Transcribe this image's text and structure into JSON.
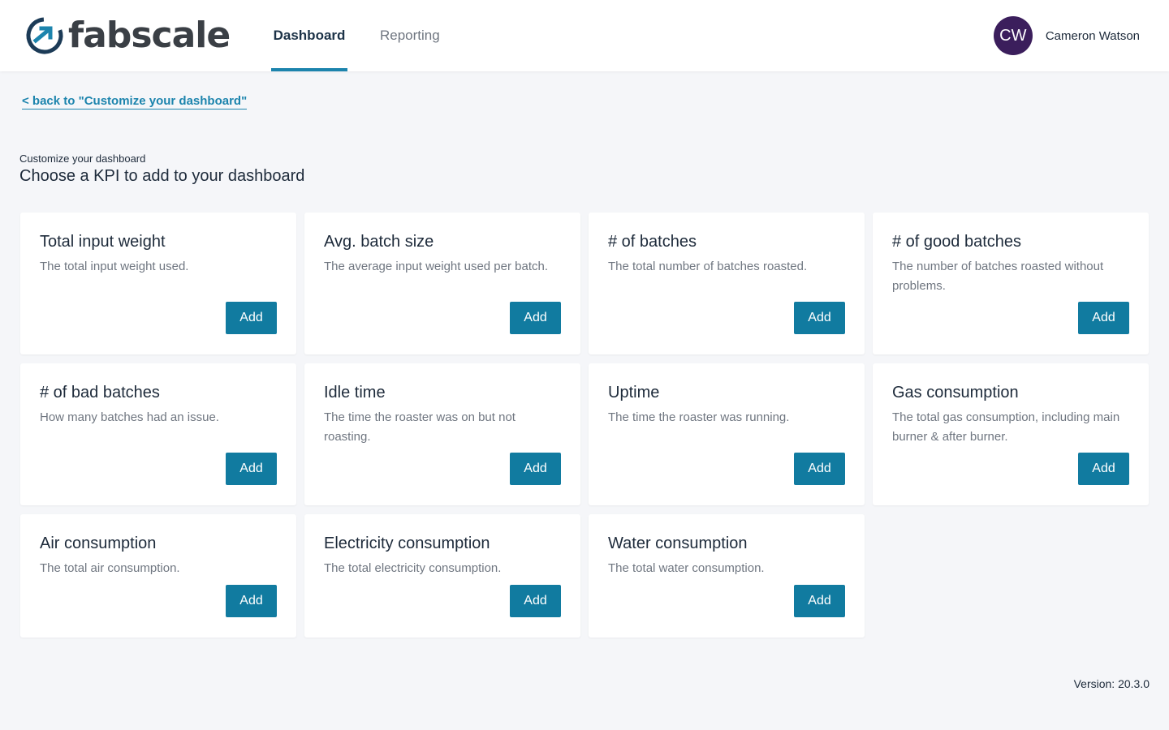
{
  "header": {
    "logo_text": "fabscale",
    "tabs": [
      {
        "label": "Dashboard",
        "active": true
      },
      {
        "label": "Reporting",
        "active": false
      }
    ],
    "user": {
      "initials": "CW",
      "name": "Cameron Watson"
    }
  },
  "page": {
    "back_link": "< back to \"Customize your dashboard\"",
    "subtitle": "Customize your dashboard",
    "title": "Choose a KPI to add to your dashboard"
  },
  "kpis": [
    {
      "title": "Total input weight",
      "description": "The total input weight used.",
      "button": "Add"
    },
    {
      "title": "Avg. batch size",
      "description": "The average input weight used per batch.",
      "button": "Add"
    },
    {
      "title": "# of batches",
      "description": "The total number of batches roasted.",
      "button": "Add"
    },
    {
      "title": "# of good batches",
      "description": "The number of batches roasted without problems.",
      "button": "Add"
    },
    {
      "title": "# of bad batches",
      "description": "How many batches had an issue.",
      "button": "Add"
    },
    {
      "title": "Idle time",
      "description": "The time the roaster was on but not roasting.",
      "button": "Add"
    },
    {
      "title": "Uptime",
      "description": "The time the roaster was running.",
      "button": "Add"
    },
    {
      "title": "Gas consumption",
      "description": "The total gas consumption, including main burner & after burner.",
      "button": "Add"
    },
    {
      "title": "Air consumption",
      "description": "The total air consumption.",
      "button": "Add"
    },
    {
      "title": "Electricity consumption",
      "description": "The total electricity consumption.",
      "button": "Add"
    },
    {
      "title": "Water consumption",
      "description": "The total water consumption.",
      "button": "Add"
    }
  ],
  "footer": {
    "version": "Version: 20.3.0"
  },
  "colors": {
    "accent": "#1c84ad",
    "button": "#117ba0",
    "avatar": "#3b1e5c",
    "logo_dark": "#3a3f45",
    "background": "#f5f6f9"
  }
}
